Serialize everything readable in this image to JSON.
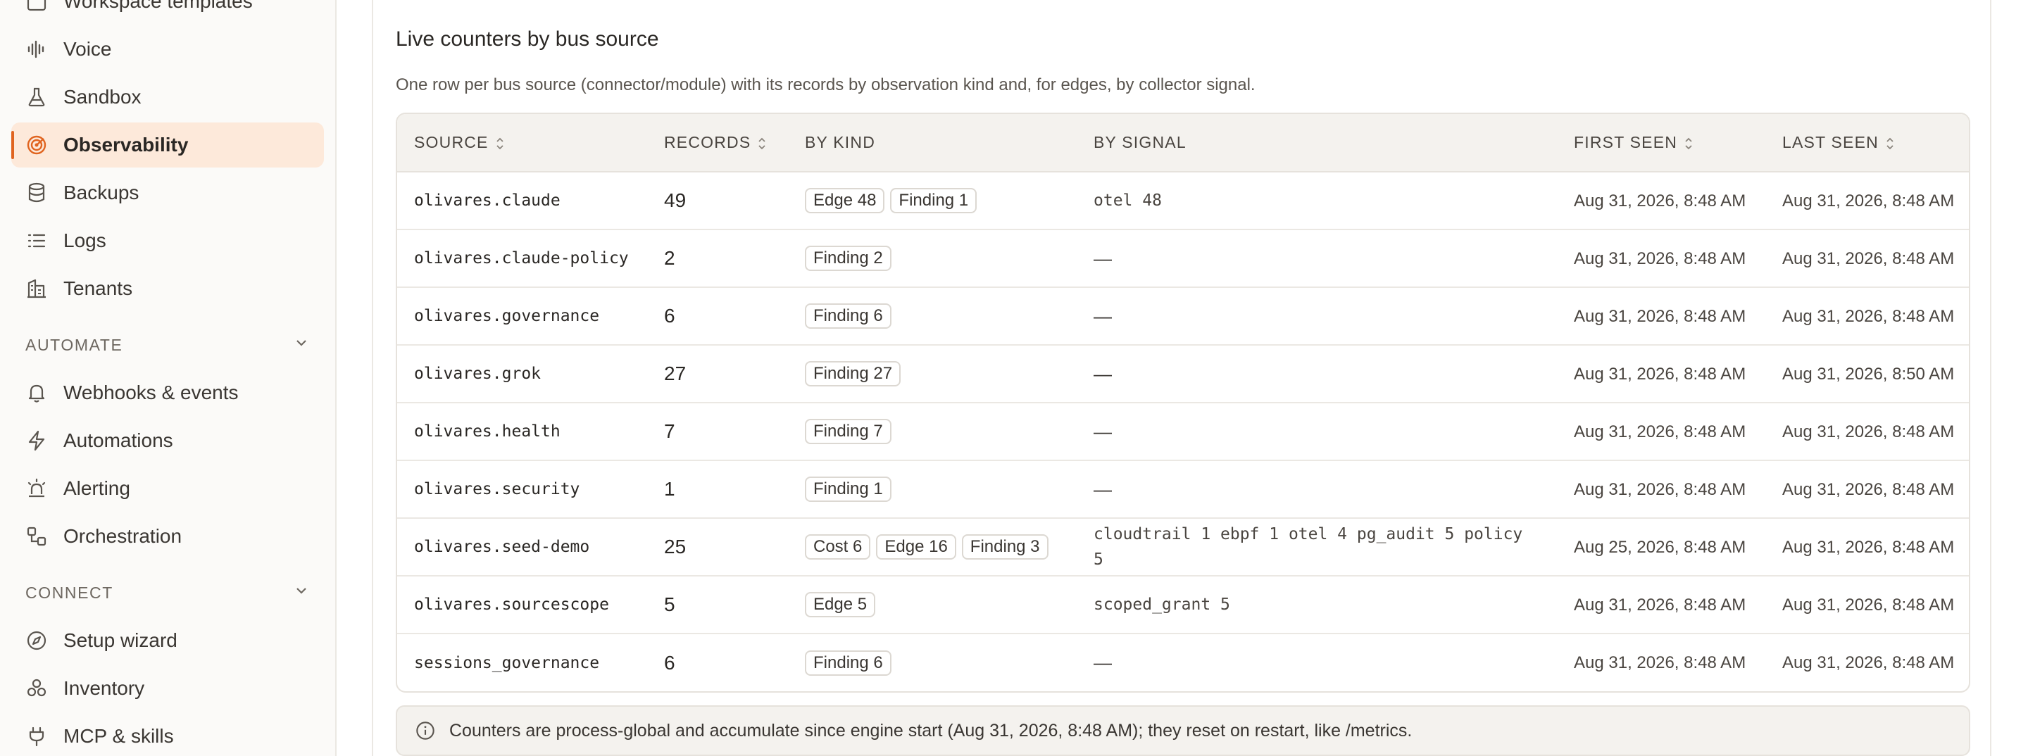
{
  "sidebar": {
    "top_items": [
      {
        "label": "Workspace templates",
        "icon": "template-icon"
      },
      {
        "label": "Voice",
        "icon": "audio-wave-icon"
      },
      {
        "label": "Sandbox",
        "icon": "flask-icon"
      },
      {
        "label": "Observability",
        "icon": "radar-icon",
        "active": true
      },
      {
        "label": "Backups",
        "icon": "database-icon"
      },
      {
        "label": "Logs",
        "icon": "list-icon"
      },
      {
        "label": "Tenants",
        "icon": "building-icon"
      }
    ],
    "automate_label": "AUTOMATE",
    "automate_items": [
      {
        "label": "Webhooks & events",
        "icon": "bell-icon"
      },
      {
        "label": "Automations",
        "icon": "zap-icon"
      },
      {
        "label": "Alerting",
        "icon": "siren-icon"
      },
      {
        "label": "Orchestration",
        "icon": "workflow-icon"
      }
    ],
    "connect_label": "CONNECT",
    "connect_items": [
      {
        "label": "Setup wizard",
        "icon": "compass-icon"
      },
      {
        "label": "Inventory",
        "icon": "boxes-icon"
      },
      {
        "label": "MCP & skills",
        "icon": "plug-icon"
      }
    ]
  },
  "card": {
    "title": "Live counters by bus source",
    "subtitle": "One row per bus source (connector/module) with its records by observation kind and, for edges, by collector signal."
  },
  "table": {
    "columns": {
      "source": "SOURCE",
      "records": "RECORDS",
      "by_kind": "BY KIND",
      "by_signal": "BY SIGNAL",
      "first_seen": "FIRST SEEN",
      "last_seen": "LAST SEEN"
    },
    "rows": [
      {
        "source": "olivares.claude",
        "records": "49",
        "kinds": [
          "Edge 48",
          "Finding 1"
        ],
        "signal": "otel 48",
        "first_seen": "Aug 31, 2026, 8:48 AM",
        "last_seen": "Aug 31, 2026, 8:48 AM"
      },
      {
        "source": "olivares.claude-policy",
        "records": "2",
        "kinds": [
          "Finding 2"
        ],
        "signal": "—",
        "first_seen": "Aug 31, 2026, 8:48 AM",
        "last_seen": "Aug 31, 2026, 8:48 AM"
      },
      {
        "source": "olivares.governance",
        "records": "6",
        "kinds": [
          "Finding 6"
        ],
        "signal": "—",
        "first_seen": "Aug 31, 2026, 8:48 AM",
        "last_seen": "Aug 31, 2026, 8:48 AM"
      },
      {
        "source": "olivares.grok",
        "records": "27",
        "kinds": [
          "Finding 27"
        ],
        "signal": "—",
        "first_seen": "Aug 31, 2026, 8:48 AM",
        "last_seen": "Aug 31, 2026, 8:50 AM"
      },
      {
        "source": "olivares.health",
        "records": "7",
        "kinds": [
          "Finding 7"
        ],
        "signal": "—",
        "first_seen": "Aug 31, 2026, 8:48 AM",
        "last_seen": "Aug 31, 2026, 8:48 AM"
      },
      {
        "source": "olivares.security",
        "records": "1",
        "kinds": [
          "Finding 1"
        ],
        "signal": "—",
        "first_seen": "Aug 31, 2026, 8:48 AM",
        "last_seen": "Aug 31, 2026, 8:48 AM"
      },
      {
        "source": "olivares.seed-demo",
        "records": "25",
        "kinds": [
          "Cost 6",
          "Edge 16",
          "Finding 3"
        ],
        "signal": "cloudtrail 1 ebpf 1 otel 4 pg_audit 5 policy 5",
        "first_seen": "Aug 25, 2026, 8:48 AM",
        "last_seen": "Aug 31, 2026, 8:48 AM"
      },
      {
        "source": "olivares.sourcescope",
        "records": "5",
        "kinds": [
          "Edge 5"
        ],
        "signal": "scoped_grant 5",
        "first_seen": "Aug 31, 2026, 8:48 AM",
        "last_seen": "Aug 31, 2026, 8:48 AM"
      },
      {
        "source": "sessions_governance",
        "records": "6",
        "kinds": [
          "Finding 6"
        ],
        "signal": "—",
        "first_seen": "Aug 31, 2026, 8:48 AM",
        "last_seen": "Aug 31, 2026, 8:48 AM"
      }
    ]
  },
  "note": {
    "text": "Counters are process-global and accumulate since engine start (Aug 31, 2026, 8:48 AM); they reset on restart, like /metrics."
  },
  "colors": {
    "accent": "#e0641f",
    "active_bg": "#fde9da"
  }
}
